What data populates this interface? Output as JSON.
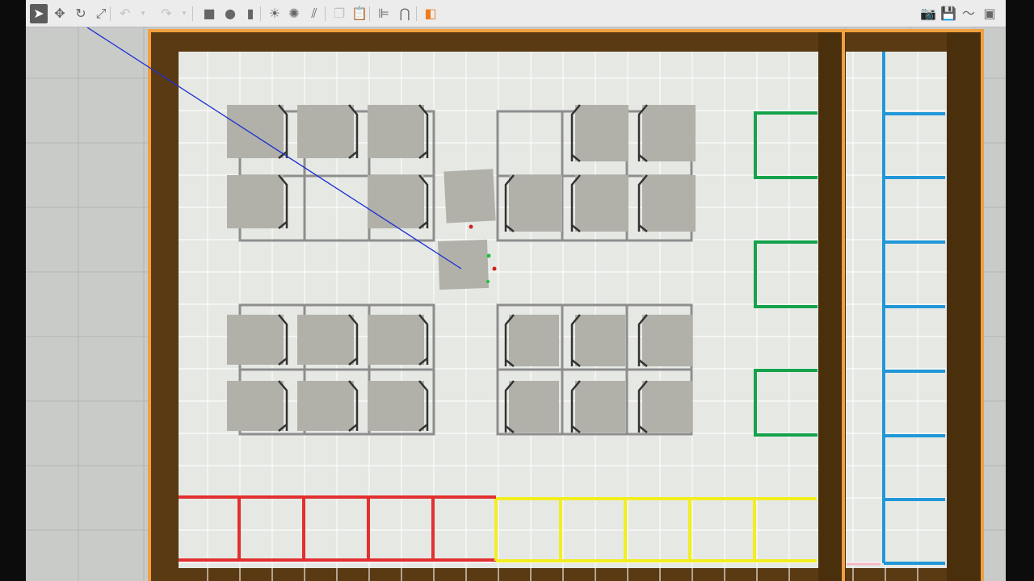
{
  "toolbar": {
    "left": [
      {
        "name": "select-mode-icon",
        "glyph": "➤",
        "state": "active"
      },
      {
        "name": "translate-mode-icon",
        "glyph": "✥",
        "state": "normal"
      },
      {
        "name": "rotate-mode-icon",
        "glyph": "↻",
        "state": "normal"
      },
      {
        "name": "scale-mode-icon",
        "glyph": "⤢",
        "state": "normal"
      },
      {
        "name": "undo-icon",
        "glyph": "↶",
        "state": "disabled"
      },
      {
        "name": "undo-history-chevron-icon",
        "glyph": "▾",
        "state": "disabled"
      },
      {
        "name": "redo-icon",
        "glyph": "↷",
        "state": "disabled"
      },
      {
        "name": "redo-history-chevron-icon",
        "glyph": "▾",
        "state": "disabled"
      },
      {
        "name": "box-shape-icon",
        "glyph": "■",
        "state": "normal"
      },
      {
        "name": "sphere-shape-icon",
        "glyph": "●",
        "state": "normal"
      },
      {
        "name": "cylinder-shape-icon",
        "glyph": "▮",
        "state": "normal"
      },
      {
        "name": "point-light-icon",
        "glyph": "☀",
        "state": "normal"
      },
      {
        "name": "spot-light-icon",
        "glyph": "✺",
        "state": "normal"
      },
      {
        "name": "directional-light-icon",
        "glyph": "⫽",
        "state": "normal"
      },
      {
        "name": "copy-icon",
        "glyph": "❐",
        "state": "disabled"
      },
      {
        "name": "paste-icon",
        "glyph": "📋",
        "state": "disabled"
      },
      {
        "name": "align-icon",
        "glyph": "⊫",
        "state": "normal"
      },
      {
        "name": "snap-icon",
        "glyph": "⋂",
        "state": "normal"
      },
      {
        "name": "change-view-angle-icon",
        "glyph": "◧",
        "state": "accent"
      }
    ],
    "right": [
      {
        "name": "screenshot-icon",
        "glyph": "📷"
      },
      {
        "name": "log-data-icon",
        "glyph": "💾"
      },
      {
        "name": "plot-icon",
        "glyph": "〜"
      },
      {
        "name": "record-video-icon",
        "glyph": "▣"
      }
    ],
    "accent_color": "#f07a1c"
  },
  "scene": {
    "colors": {
      "ground": "#c9cbc9",
      "floor": "#e6e8e4",
      "grid": "#ffffff",
      "wall_wood": "#5a3a12",
      "wall_rim": "#f0a040",
      "table_frame": "#8e8e8e",
      "box_face": "#b1b1aa",
      "box_edge": "#333333",
      "zone_red": "#e23030",
      "zone_yellow": "#f2ee20",
      "zone_green": "#14a34a",
      "zone_blue": "#2197d8",
      "ray_line": "#1a2fd0"
    }
  }
}
